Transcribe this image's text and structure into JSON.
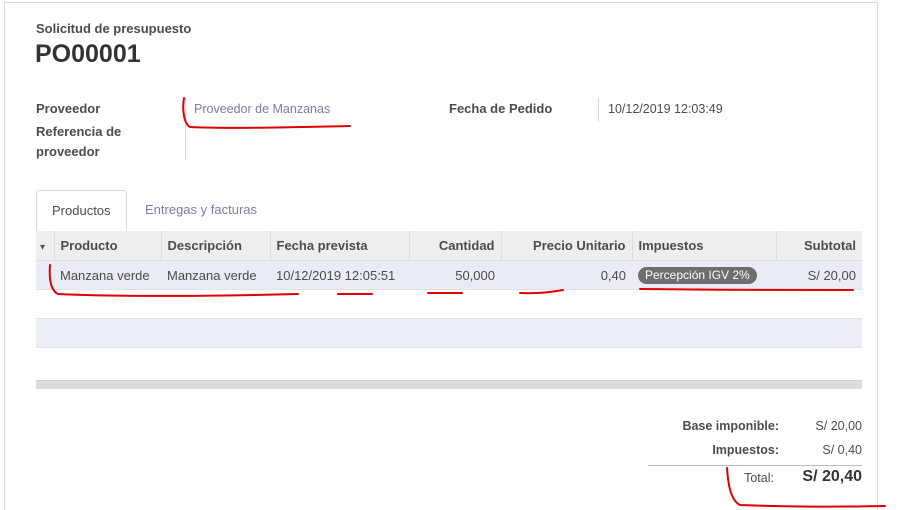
{
  "document": {
    "label": "Solicitud de presupuesto",
    "title": "PO00001"
  },
  "fields": {
    "vendor_label": "Proveedor",
    "vendor_value": "Proveedor de Manzanas",
    "vendor_ref_label_line1": "Referencia de",
    "vendor_ref_label_line2": "proveedor",
    "order_date_label": "Fecha de Pedido",
    "order_date_value": "10/12/2019 12:03:49"
  },
  "tabs": [
    {
      "label": "Productos",
      "active": true
    },
    {
      "label": "Entregas y facturas",
      "active": false
    }
  ],
  "table": {
    "columns": [
      "Producto",
      "Descripción",
      "Fecha prevista",
      "Cantidad",
      "Precio Unitario",
      "Impuestos",
      "Subtotal"
    ],
    "rows": [
      {
        "product": "Manzana verde",
        "description": "Manzana verde",
        "date": "10/12/2019 12:05:51",
        "quantity": "50,000",
        "unit_price": "0,40",
        "tax": "Percepción IGV 2%",
        "subtotal": "S/ 20,00"
      }
    ]
  },
  "totals": {
    "base_label": "Base imponible:",
    "base_value": "S/ 20,00",
    "tax_label": "Impuestos:",
    "tax_value": "S/ 0,40",
    "total_label": "Total:",
    "total_value": "S/ 20,40"
  },
  "colors": {
    "link": "#7c7bad",
    "annotation": "#e00000",
    "badge": "#6e6e6e"
  },
  "icons": {
    "sort_caret": "▾"
  }
}
